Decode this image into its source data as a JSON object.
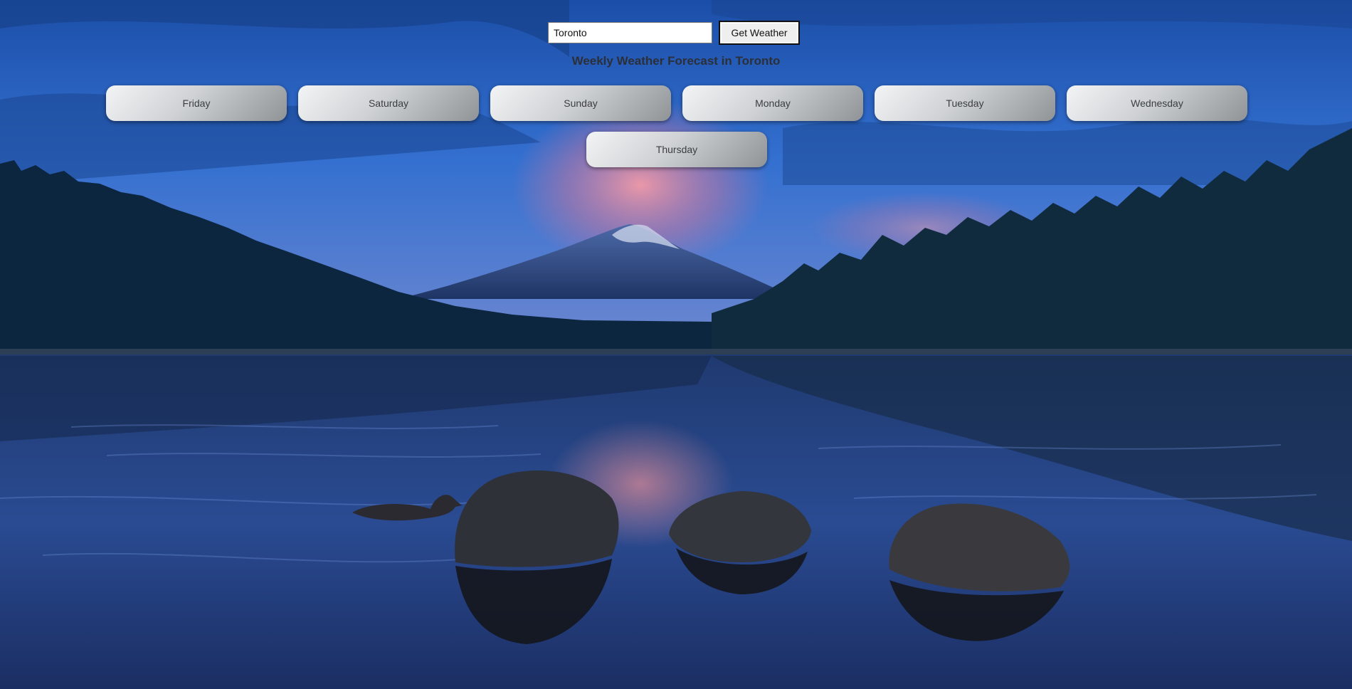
{
  "search": {
    "city_value": "Toronto",
    "button_label": "Get Weather"
  },
  "heading": "Weekly Weather Forecast in Toronto",
  "days": [
    "Friday",
    "Saturday",
    "Sunday",
    "Monday",
    "Tuesday",
    "Wednesday",
    "Thursday"
  ],
  "colors": {
    "sky_top": "#1d4fa8",
    "sky_mid": "#3b74d6",
    "sunset_pink": "#e98aa0",
    "water": "#1f3366",
    "forest": "#0d2438"
  }
}
